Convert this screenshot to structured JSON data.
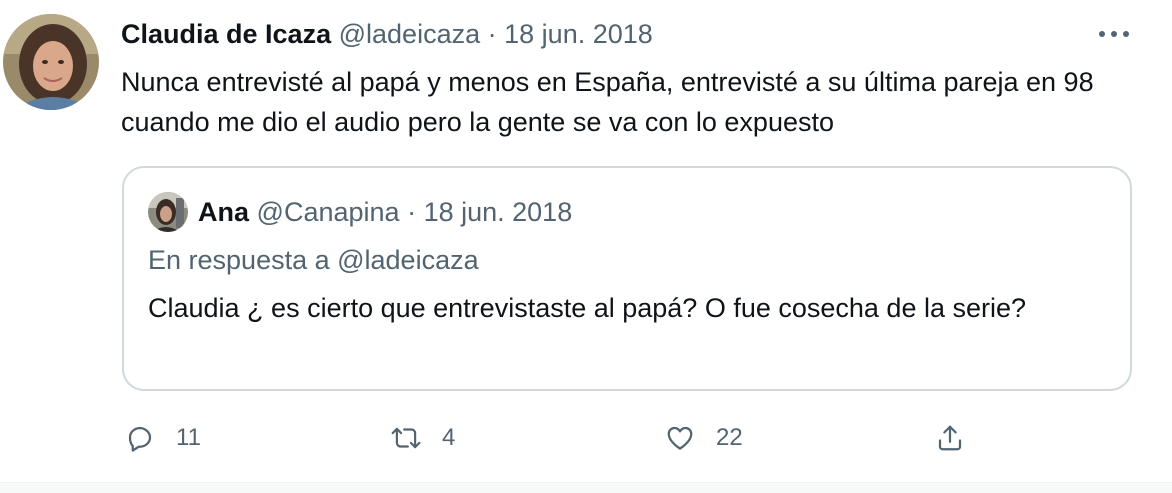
{
  "tweet": {
    "author_name": "Claudia de Icaza",
    "handle": "@ladeicaza",
    "separator": "·",
    "date": "18 jun. 2018",
    "text": "Nunca entrevisté al papá y menos en España, entrevisté a su última pareja en 98 cuando me dio el audio pero la gente se va con lo expuesto"
  },
  "quoted": {
    "author_name": "Ana",
    "handle": "@Canapina",
    "separator": "·",
    "date": "18 jun. 2018",
    "reply_to": "En respuesta a @ladeicaza",
    "text": "Claudia ¿ es cierto que entrevistaste al papá? O fue cosecha de la serie?"
  },
  "actions": {
    "reply_count": "11",
    "retweet_count": "4",
    "like_count": "22"
  },
  "icons": {
    "more": "more-horizontal-icon",
    "reply": "reply-icon",
    "retweet": "retweet-icon",
    "like": "heart-icon",
    "share": "share-icon"
  },
  "colors": {
    "text_primary": "#0f1419",
    "text_secondary": "#536471",
    "border": "#cfd9de"
  }
}
